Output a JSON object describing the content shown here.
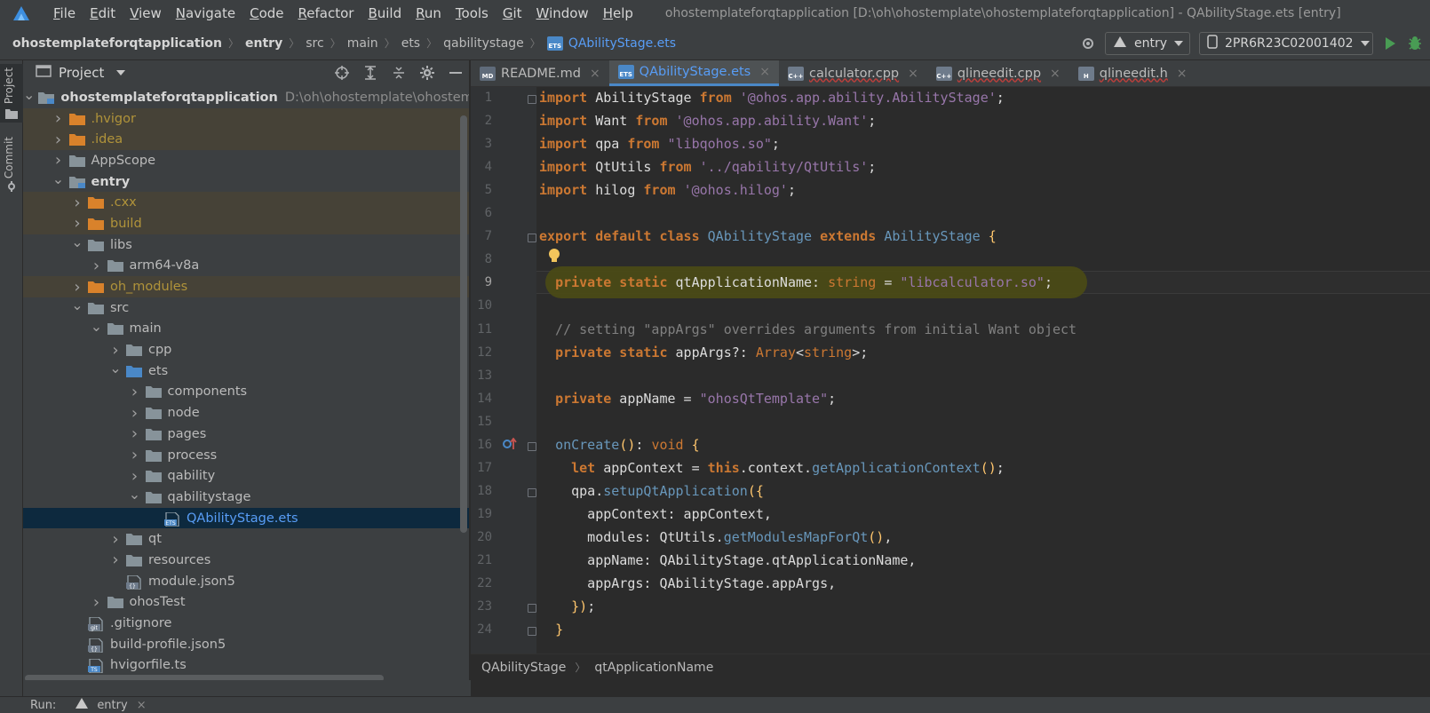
{
  "menubar": {
    "items": [
      "File",
      "Edit",
      "View",
      "Navigate",
      "Code",
      "Refactor",
      "Build",
      "Run",
      "Tools",
      "Git",
      "Window",
      "Help"
    ],
    "window_title": "ohostemplateforqtapplication [D:\\oh\\ohostemplate\\ohostemplateforqtapplication] - QAbilityStage.ets [entry]"
  },
  "breadcrumb": {
    "items": [
      "ohostemplateforqtapplication",
      "entry",
      "src",
      "main",
      "ets",
      "qabilitystage",
      "QAbilityStage.ets"
    ]
  },
  "toolbar": {
    "run_config": "entry",
    "device": "2PR6R23C02001402"
  },
  "left_strip": {
    "project_tab": "Project",
    "commit_tab": "Commit"
  },
  "project_panel": {
    "title": "Project",
    "tree": [
      {
        "label": "ohostemplateforqtapplication",
        "hint": "D:\\oh\\ohostemplate\\ohostemplateforqtapplication",
        "depth": 0,
        "expanded": true,
        "type": "module",
        "bold": true
      },
      {
        "label": ".hvigor",
        "depth": 1,
        "expanded": false,
        "type": "folder-excluded"
      },
      {
        "label": ".idea",
        "depth": 1,
        "expanded": false,
        "type": "folder-excluded"
      },
      {
        "label": "AppScope",
        "depth": 1,
        "expanded": false,
        "type": "folder"
      },
      {
        "label": "entry",
        "depth": 1,
        "expanded": true,
        "type": "module",
        "bold": true
      },
      {
        "label": ".cxx",
        "depth": 2,
        "expanded": false,
        "type": "folder-excluded"
      },
      {
        "label": "build",
        "depth": 2,
        "expanded": false,
        "type": "folder-excluded"
      },
      {
        "label": "libs",
        "depth": 2,
        "expanded": true,
        "type": "folder"
      },
      {
        "label": "arm64-v8a",
        "depth": 3,
        "expanded": false,
        "type": "folder"
      },
      {
        "label": "oh_modules",
        "depth": 2,
        "expanded": false,
        "type": "folder-excluded"
      },
      {
        "label": "src",
        "depth": 2,
        "expanded": true,
        "type": "folder"
      },
      {
        "label": "main",
        "depth": 3,
        "expanded": true,
        "type": "folder"
      },
      {
        "label": "cpp",
        "depth": 4,
        "expanded": false,
        "type": "folder"
      },
      {
        "label": "ets",
        "depth": 4,
        "expanded": true,
        "type": "folder-src"
      },
      {
        "label": "components",
        "depth": 5,
        "expanded": false,
        "type": "folder"
      },
      {
        "label": "node",
        "depth": 5,
        "expanded": false,
        "type": "folder"
      },
      {
        "label": "pages",
        "depth": 5,
        "expanded": false,
        "type": "folder"
      },
      {
        "label": "process",
        "depth": 5,
        "expanded": false,
        "type": "folder"
      },
      {
        "label": "qability",
        "depth": 5,
        "expanded": false,
        "type": "folder"
      },
      {
        "label": "qabilitystage",
        "depth": 5,
        "expanded": true,
        "type": "folder"
      },
      {
        "label": "QAbilityStage.ets",
        "depth": 6,
        "type": "file-ets",
        "selected": true
      },
      {
        "label": "qt",
        "depth": 4,
        "expanded": false,
        "type": "folder"
      },
      {
        "label": "resources",
        "depth": 4,
        "expanded": false,
        "type": "folder"
      },
      {
        "label": "module.json5",
        "depth": 4,
        "type": "file-json"
      },
      {
        "label": "ohosTest",
        "depth": 3,
        "expanded": false,
        "type": "folder"
      },
      {
        "label": ".gitignore",
        "depth": 2,
        "type": "file-git"
      },
      {
        "label": "build-profile.json5",
        "depth": 2,
        "type": "file-json"
      },
      {
        "label": "hvigorfile.ts",
        "depth": 2,
        "type": "file-ts"
      }
    ]
  },
  "editor": {
    "tabs": [
      {
        "label": "README.md",
        "icon": "MD",
        "color": "#5f6b7a",
        "active": false,
        "error": false
      },
      {
        "label": "QAbilityStage.ets",
        "icon": "ETS",
        "color": "#4a88c7",
        "active": true,
        "error": false
      },
      {
        "label": "calculator.cpp",
        "icon": "C++",
        "color": "#6e7b8b",
        "active": false,
        "error": true
      },
      {
        "label": "qlineedit.cpp",
        "icon": "C++",
        "color": "#6e7b8b",
        "active": false,
        "error": true
      },
      {
        "label": "qlineedit.h",
        "icon": "H",
        "color": "#6e7b8b",
        "active": false,
        "error": true
      }
    ],
    "lines": [
      [
        [
          "kw",
          "import"
        ],
        [
          "t",
          " AbilityStage "
        ],
        [
          "kw",
          "from"
        ],
        [
          "t",
          " "
        ],
        [
          "str",
          "'@ohos.app.ability.AbilityStage'"
        ],
        [
          "t",
          ";"
        ]
      ],
      [
        [
          "kw",
          "import"
        ],
        [
          "t",
          " Want "
        ],
        [
          "kw",
          "from"
        ],
        [
          "t",
          " "
        ],
        [
          "str",
          "'@ohos.app.ability.Want'"
        ],
        [
          "t",
          ";"
        ]
      ],
      [
        [
          "kw",
          "import"
        ],
        [
          "t",
          " qpa "
        ],
        [
          "kw",
          "from"
        ],
        [
          "t",
          " "
        ],
        [
          "str",
          "\"libqohos.so\""
        ],
        [
          "t",
          ";"
        ]
      ],
      [
        [
          "kw",
          "import"
        ],
        [
          "t",
          " QtUtils "
        ],
        [
          "kw",
          "from"
        ],
        [
          "t",
          " "
        ],
        [
          "str",
          "'../qability/QtUtils'"
        ],
        [
          "t",
          ";"
        ]
      ],
      [
        [
          "kw",
          "import"
        ],
        [
          "t",
          " hilog "
        ],
        [
          "kw",
          "from"
        ],
        [
          "t",
          " "
        ],
        [
          "str",
          "'@ohos.hilog'"
        ],
        [
          "t",
          ";"
        ]
      ],
      [],
      [
        [
          "kw",
          "export default class"
        ],
        [
          "t",
          " "
        ],
        [
          "cls",
          "QAbilityStage"
        ],
        [
          "t",
          " "
        ],
        [
          "kw",
          "extends"
        ],
        [
          "t",
          " "
        ],
        [
          "cls",
          "AbilityStage"
        ],
        [
          "t",
          " "
        ],
        [
          "fn",
          "{"
        ]
      ],
      [],
      [
        [
          "t",
          "  "
        ],
        [
          "kw",
          "private static"
        ],
        [
          "t",
          " qtApplicationName: "
        ],
        [
          "typ",
          "string"
        ],
        [
          "t",
          " = "
        ],
        [
          "str",
          "\"libcalculator.so\""
        ],
        [
          "t",
          ";"
        ]
      ],
      [],
      [
        [
          "cmt",
          "  // setting \"appArgs\" overrides arguments from initial Want object"
        ]
      ],
      [
        [
          "t",
          "  "
        ],
        [
          "kw",
          "private static"
        ],
        [
          "t",
          " appArgs?: "
        ],
        [
          "typ",
          "Array"
        ],
        [
          "t",
          "<"
        ],
        [
          "typ",
          "string"
        ],
        [
          "t",
          ">;"
        ]
      ],
      [],
      [
        [
          "t",
          "  "
        ],
        [
          "kw",
          "private"
        ],
        [
          "t",
          " appName = "
        ],
        [
          "str",
          "\"ohosQtTemplate\""
        ],
        [
          "t",
          ";"
        ]
      ],
      [],
      [
        [
          "t",
          "  "
        ],
        [
          "cls",
          "onCreate"
        ],
        [
          "rpar",
          "()"
        ],
        [
          "t",
          ": "
        ],
        [
          "typ",
          "void"
        ],
        [
          "t",
          " "
        ],
        [
          "fn",
          "{"
        ]
      ],
      [
        [
          "t",
          "    "
        ],
        [
          "kw",
          "let"
        ],
        [
          "t",
          " appContext = "
        ],
        [
          "kw",
          "this"
        ],
        [
          "t",
          ".context."
        ],
        [
          "cls",
          "getApplicationContext"
        ],
        [
          "rpar",
          "()"
        ],
        [
          "t",
          ";"
        ]
      ],
      [
        [
          "t",
          "    qpa."
        ],
        [
          "cls",
          "setupQtApplication"
        ],
        [
          "rpar",
          "("
        ],
        [
          "fn",
          "{"
        ]
      ],
      [
        [
          "t",
          "      appContext: appContext,"
        ]
      ],
      [
        [
          "t",
          "      modules: QtUtils."
        ],
        [
          "cls",
          "getModulesMapForQt"
        ],
        [
          "rpar",
          "()"
        ],
        [
          "t",
          ","
        ]
      ],
      [
        [
          "t",
          "      appName: QAbilityStage.qtApplicationName,"
        ]
      ],
      [
        [
          "t",
          "      appArgs: QAbilityStage.appArgs,"
        ]
      ],
      [
        [
          "t",
          "    "
        ],
        [
          "fn",
          "}"
        ],
        [
          "rpar",
          ")"
        ],
        [
          "t",
          ";"
        ]
      ],
      [
        [
          "t",
          "  "
        ],
        [
          "fn",
          "}"
        ]
      ]
    ],
    "line_numbers": [
      "1",
      "2",
      "3",
      "4",
      "5",
      "6",
      "7",
      "8",
      "9",
      "10",
      "11",
      "12",
      "13",
      "14",
      "15",
      "16",
      "17",
      "18",
      "19",
      "20",
      "21",
      "22",
      "23",
      "24"
    ],
    "current_line": "9",
    "structure_crumbs": [
      "QAbilityStage",
      "qtApplicationName"
    ]
  },
  "runbar": {
    "label": "Run:",
    "config": "entry"
  }
}
